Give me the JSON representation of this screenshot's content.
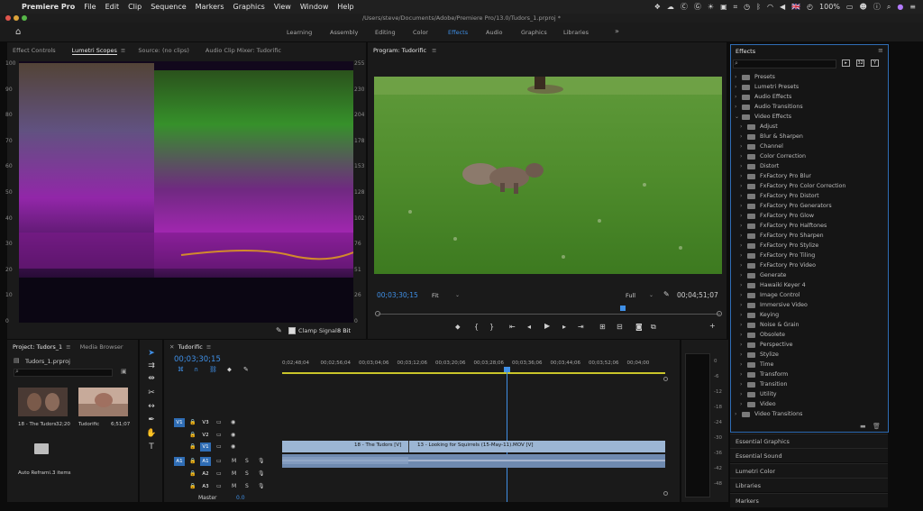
{
  "menu": {
    "apple": "",
    "app": "Premiere Pro",
    "items": [
      "File",
      "Edit",
      "Clip",
      "Sequence",
      "Markers",
      "Graphics",
      "View",
      "Window",
      "Help"
    ],
    "battery": "100%",
    "flag": "🇬🇧"
  },
  "title": "/Users/steve/Documents/Adobe/Premiere Pro/13.0/Tudors_1.prproj *",
  "workspaces": {
    "items": [
      "Learning",
      "Assembly",
      "Editing",
      "Color",
      "Effects",
      "Audio",
      "Graphics",
      "Libraries"
    ],
    "active": "Effects",
    "more": "»"
  },
  "left_panel": {
    "tabs": [
      "Effect Controls",
      "Lumetri Scopes",
      "Source: (no clips)",
      "Audio Clip Mixer: Tudorific"
    ],
    "active": "Lumetri Scopes",
    "scale_left": [
      "100",
      "90",
      "80",
      "70",
      "60",
      "50",
      "40",
      "30",
      "20",
      "10",
      "0"
    ],
    "scale_right": [
      "255",
      "230",
      "204",
      "178",
      "153",
      "128",
      "102",
      "76",
      "51",
      "26",
      "0"
    ],
    "clamp_label": "Clamp Signal",
    "bit_depth": "8 Bit"
  },
  "program": {
    "tab": "Program: Tudorific",
    "timecode_in": "00;03;30;15",
    "fit": "Fit",
    "quality": "Full",
    "timecode_out": "00;04;51;07"
  },
  "effects": {
    "title": "Effects",
    "items": [
      {
        "label": "Presets",
        "level": 0
      },
      {
        "label": "Lumetri Presets",
        "level": 0
      },
      {
        "label": "Audio Effects",
        "level": 0
      },
      {
        "label": "Audio Transitions",
        "level": 0
      },
      {
        "label": "Video Effects",
        "level": 0,
        "open": true
      },
      {
        "label": "Adjust",
        "level": 1
      },
      {
        "label": "Blur & Sharpen",
        "level": 1
      },
      {
        "label": "Channel",
        "level": 1
      },
      {
        "label": "Color Correction",
        "level": 1
      },
      {
        "label": "Distort",
        "level": 1
      },
      {
        "label": "FxFactory Pro Blur",
        "level": 1
      },
      {
        "label": "FxFactory Pro Color Correction",
        "level": 1
      },
      {
        "label": "FxFactory Pro Distort",
        "level": 1
      },
      {
        "label": "FxFactory Pro Generators",
        "level": 1
      },
      {
        "label": "FxFactory Pro Glow",
        "level": 1
      },
      {
        "label": "FxFactory Pro Halftones",
        "level": 1
      },
      {
        "label": "FxFactory Pro Sharpen",
        "level": 1
      },
      {
        "label": "FxFactory Pro Stylize",
        "level": 1
      },
      {
        "label": "FxFactory Pro Tiling",
        "level": 1
      },
      {
        "label": "FxFactory Pro Video",
        "level": 1
      },
      {
        "label": "Generate",
        "level": 1
      },
      {
        "label": "Hawaiki Keyer 4",
        "level": 1
      },
      {
        "label": "Image Control",
        "level": 1
      },
      {
        "label": "Immersive Video",
        "level": 1
      },
      {
        "label": "Keying",
        "level": 1
      },
      {
        "label": "Noise & Grain",
        "level": 1
      },
      {
        "label": "Obsolete",
        "level": 1
      },
      {
        "label": "Perspective",
        "level": 1
      },
      {
        "label": "Stylize",
        "level": 1
      },
      {
        "label": "Time",
        "level": 1
      },
      {
        "label": "Transform",
        "level": 1
      },
      {
        "label": "Transition",
        "level": 1
      },
      {
        "label": "Utility",
        "level": 1
      },
      {
        "label": "Video",
        "level": 1
      },
      {
        "label": "Video Transitions",
        "level": 0
      }
    ],
    "panels": [
      "Essential Graphics",
      "Essential Sound",
      "Lumetri Color",
      "Libraries",
      "Markers"
    ]
  },
  "project": {
    "tabs": [
      "Project: Tudors_1",
      "Media Browser"
    ],
    "file": "Tudors_1.prproj",
    "items": [
      {
        "name": "18 - The Tudors",
        "duration": "32;20"
      },
      {
        "name": "Tudorific",
        "duration": "6;51;07"
      },
      {
        "name": "Auto Reframed Sequences",
        "short": "Auto Reframi...",
        "count": "3 items"
      }
    ]
  },
  "timeline": {
    "tab": "Tudorific",
    "timecode": "00;03;30;15",
    "ruler": [
      "0;02;48;04",
      "00;02;56;04",
      "00;03;04;06",
      "00;03;12;06",
      "00;03;20;06",
      "00;03;28;06",
      "00;03;36;06",
      "00;03;44;06",
      "00;03;52;06",
      "00;04;00"
    ],
    "video_tracks": [
      "V3",
      "V2",
      "V1"
    ],
    "audio_tracks": [
      "A1",
      "A2",
      "A3"
    ],
    "master": "Master",
    "master_value": "0.0",
    "clip1": "18 - The Tudors [V]",
    "clip2": "13 - Looking for Squirrels (15-May-11).MOV [V]",
    "meter_scale": [
      "0",
      "-6",
      "-12",
      "-18",
      "-24",
      "-30",
      "-36",
      "-42",
      "-48"
    ],
    "source_patch_v": "V1",
    "source_patch_a": "A1",
    "mute": "M",
    "solo": "S"
  }
}
